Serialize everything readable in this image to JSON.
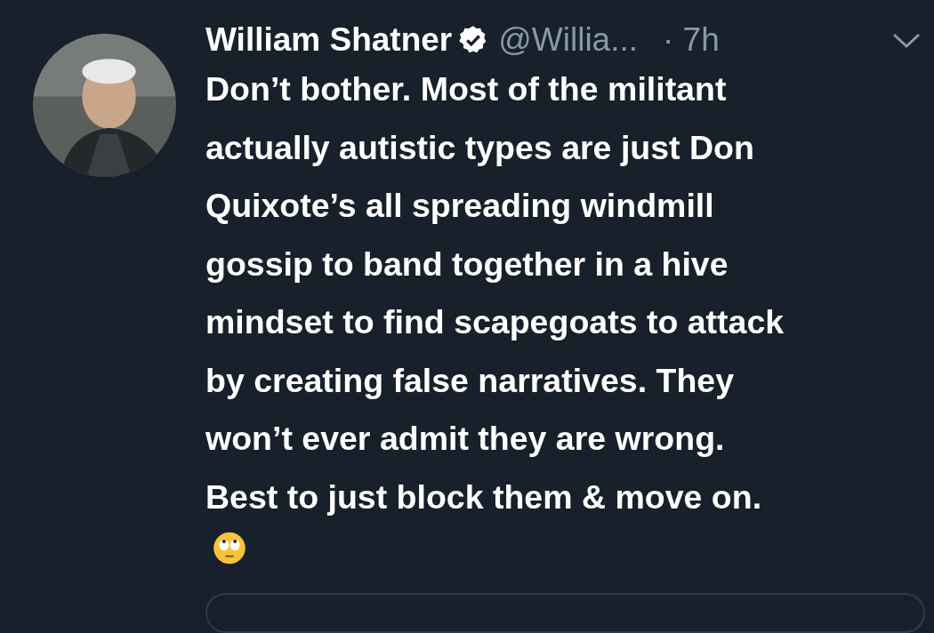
{
  "tweet": {
    "author": {
      "name": "William Shatner",
      "verified": true,
      "handle": "@Willia...",
      "time": "· 7h"
    },
    "text": "Don’t bother. Most of the militant\nactually autistic types are just Don\nQuixote’s all spreading windmill\ngossip to band together in a hive\nmindset to find scapegoats to attack\nby creating false narratives. They\nwon’t ever admit they are wrong.\nBest to just block them & move on."
  }
}
